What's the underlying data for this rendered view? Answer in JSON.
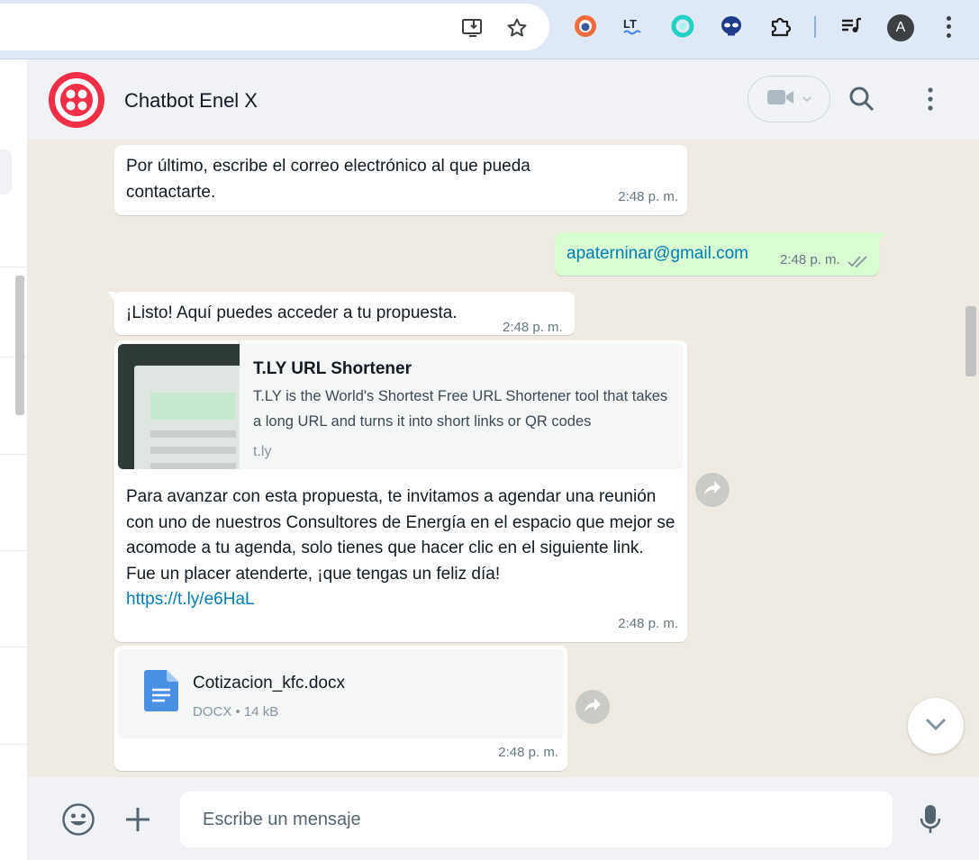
{
  "browser": {
    "omnibox_icons": [
      "install-app-icon",
      "bookmark-star-icon"
    ],
    "extensions": [
      "extension-orange-circle-icon",
      "extension-languagetool-icon",
      "extension-teal-ring-icon",
      "extension-alien-icon",
      "extensions-puzzle-icon",
      "media-control-icon"
    ],
    "profile_initial": "A",
    "accent_color": "#dfe8f5"
  },
  "chat": {
    "title": "Chatbot Enel X",
    "brand_color": "#f22f46",
    "header_icons": [
      "video-call-icon",
      "search-icon",
      "menu-icon"
    ]
  },
  "messages": [
    {
      "direction": "incoming",
      "text": "Por último, escribe el correo electrónico al que pueda contactarte.",
      "time": "2:48 p. m."
    },
    {
      "direction": "outgoing",
      "text": "apaterninar@gmail.com",
      "time": "2:48 p. m.",
      "status": "read"
    },
    {
      "direction": "incoming",
      "text": "¡Listo! Aquí puedes acceder a tu propuesta.",
      "time": "2:48 p. m."
    },
    {
      "direction": "incoming",
      "link_preview": {
        "title": "T.LY URL Shortener",
        "description": "T.LY is the World's Shortest Free URL Shortener tool that takes a long URL and turns it into short links or QR codes",
        "domain": "t.ly"
      },
      "text": "Para avanzar con esta propuesta, te invitamos a agendar una reunión con uno de nuestros Consultores de Energía en el espacio que mejor se acomode a tu agenda, solo tienes que hacer clic en el siguiente link. Fue un placer atenderte, ¡que tengas un feliz día!",
      "link": "https://t.ly/e6HaL",
      "time": "2:48 p. m."
    },
    {
      "direction": "incoming",
      "document": {
        "name": "Cotizacion_kfc.docx",
        "meta": "DOCX • 14 kB"
      },
      "time": "2:48 p. m."
    }
  ],
  "composer": {
    "placeholder": "Escribe un mensaje"
  },
  "colors": {
    "outgoing_bubble": "#d9fdd3",
    "chat_background": "#efeae2",
    "link_color": "#027eb5",
    "read_ticks": "#8696a0"
  }
}
